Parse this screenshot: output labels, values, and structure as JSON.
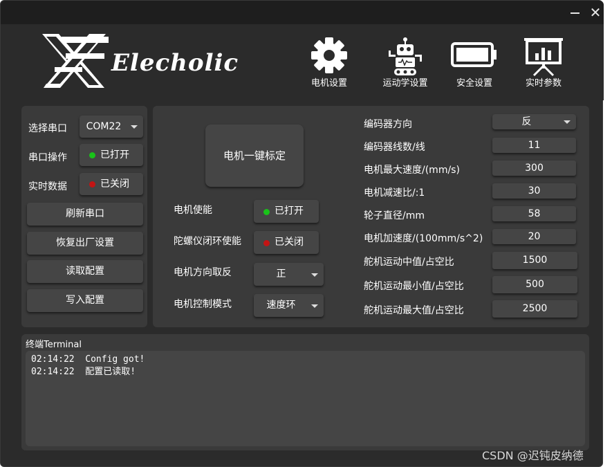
{
  "window": {
    "minimize_label": "—",
    "close_label": "✕"
  },
  "header": {
    "brand": "Elecholic",
    "nav": [
      {
        "label": "电机设置",
        "icon": "gear-icon"
      },
      {
        "label": "运动学设置",
        "icon": "robot-icon"
      },
      {
        "label": "安全设置",
        "icon": "battery-icon"
      },
      {
        "label": "实时参数",
        "icon": "presentation-chart-icon"
      }
    ]
  },
  "left": {
    "port_label": "选择串口",
    "port_value": "COM22",
    "port_op_label": "串口操作",
    "port_op_state": "已打开",
    "realtime_label": "实时数据",
    "realtime_state": "已关闭",
    "refresh_button": "刷新串口",
    "factory_button": "恢复出厂设置",
    "read_button": "读取配置",
    "write_button": "写入配置"
  },
  "main": {
    "calibrate_button": "电机一键标定",
    "motor_enable_label": "电机使能",
    "motor_enable_state": "已打开",
    "gyro_label": "陀螺仪闭环使能",
    "gyro_state": "已关闭",
    "dir_label": "电机方向取反",
    "dir_value": "正",
    "mode_label": "电机控制模式",
    "mode_value": "速度环"
  },
  "params": [
    {
      "label": "编码器方向",
      "value": "反",
      "type": "select"
    },
    {
      "label": "编码器线数/线",
      "value": "11",
      "type": "field"
    },
    {
      "label": "电机最大速度/(mm/s)",
      "value": "300",
      "type": "field"
    },
    {
      "label": "电机减速比/:1",
      "value": "30",
      "type": "field"
    },
    {
      "label": "轮子直径/mm",
      "value": "58",
      "type": "field"
    },
    {
      "label": "电机加速度/(100mm/s^2)",
      "value": "20",
      "type": "field"
    },
    {
      "label": "舵机运动中值/占空比",
      "value": "1500",
      "type": "field"
    },
    {
      "label": "舵机运动最小值/占空比",
      "value": "500",
      "type": "field"
    },
    {
      "label": "舵机运动最大值/占空比",
      "value": "2500",
      "type": "field"
    }
  ],
  "terminal": {
    "title": "终端Terminal",
    "lines": [
      "02:14:22  Config got!",
      "02:14:22  配置已读取!"
    ]
  },
  "watermark": "CSDN @迟钝皮纳德",
  "colors": {
    "on": "#19c319",
    "off": "#c31414",
    "panel": "#3a3a3a",
    "bg": "#2b2b2b"
  }
}
